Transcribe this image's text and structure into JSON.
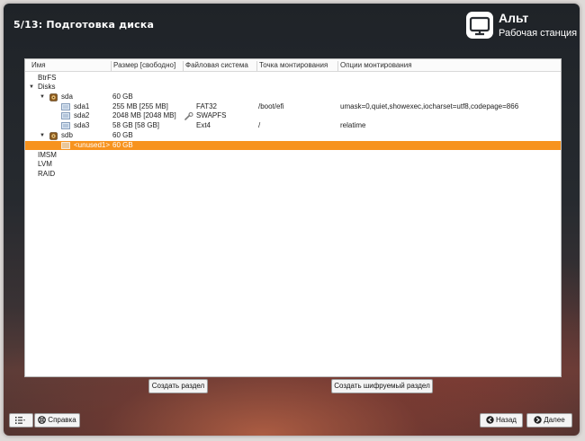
{
  "window": {
    "title": "5/13: Подготовка диска",
    "brand_name": "Альт",
    "brand_sub": "Рабочая станция"
  },
  "table": {
    "columns": [
      "Имя",
      "Размер [свободно]",
      "Файловая система",
      "Точка монтирования",
      "Опции монтирования"
    ],
    "rows": [
      {
        "name": "BtrFS"
      },
      {
        "name": "Disks"
      },
      {
        "name": "sda",
        "size": "60 GB"
      },
      {
        "name": "sda1",
        "size": "255 MB [255 MB]",
        "fs": "FAT32",
        "mount": "/boot/efi",
        "options": "umask=0,quiet,showexec,iocharset=utf8,codepage=866"
      },
      {
        "name": "sda2",
        "size": "2048 MB [2048 MB]",
        "fs": "SWAPFS"
      },
      {
        "name": "sda3",
        "size": "58 GB [58 GB]",
        "fs": "Ext4",
        "mount": "/",
        "options": "relatime"
      },
      {
        "name": "sdb",
        "size": "60 GB"
      },
      {
        "name": "<unused1>",
        "size": "60 GB"
      },
      {
        "name": "IMSM"
      },
      {
        "name": "LVM"
      },
      {
        "name": "RAID"
      }
    ]
  },
  "buttons": {
    "create_partition": "Создать раздел",
    "create_encrypted": "Создать шифруемый раздел",
    "help": "Справка",
    "back": "Назад",
    "next": "Далее"
  },
  "colors": {
    "selection": "#f7931e",
    "panel": "#ffffff"
  }
}
